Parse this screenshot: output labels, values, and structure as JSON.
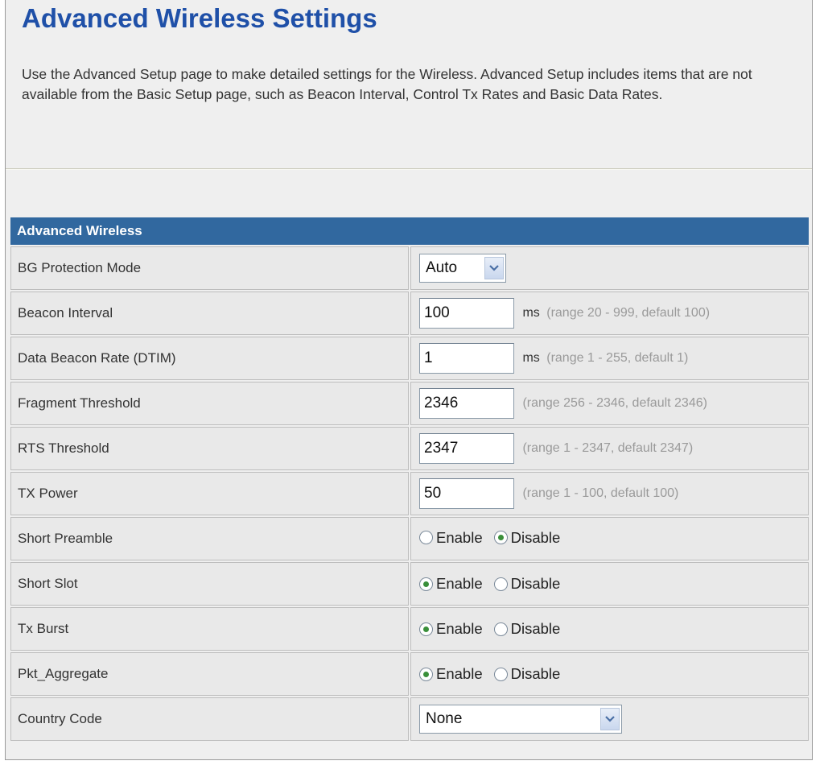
{
  "page": {
    "title": "Advanced Wireless Settings",
    "description": "Use the Advanced Setup page to make detailed settings for the Wireless. Advanced Setup includes items that are not available from the Basic Setup page, such as Beacon Interval, Control Tx Rates and Basic Data Rates."
  },
  "table": {
    "header": "Advanced Wireless",
    "bg_protection": {
      "label": "BG Protection Mode",
      "value": "Auto"
    },
    "beacon_interval": {
      "label": "Beacon Interval",
      "value": "100",
      "unit": "ms",
      "hint": "(range 20 - 999, default 100)"
    },
    "dtim": {
      "label": "Data Beacon Rate (DTIM)",
      "value": "1",
      "unit": "ms",
      "hint": "(range 1 - 255, default 1)"
    },
    "fragment": {
      "label": "Fragment Threshold",
      "value": "2346",
      "hint": "(range 256 - 2346, default 2346)"
    },
    "rts": {
      "label": "RTS Threshold",
      "value": "2347",
      "hint": "(range 1 - 2347, default 2347)"
    },
    "tx_power": {
      "label": "TX Power",
      "value": "50",
      "hint": "(range 1 - 100, default 100)"
    },
    "short_preamble": {
      "label": "Short Preamble",
      "enable": "Enable",
      "disable": "Disable",
      "selected": "disable"
    },
    "short_slot": {
      "label": "Short Slot",
      "enable": "Enable",
      "disable": "Disable",
      "selected": "enable"
    },
    "tx_burst": {
      "label": "Tx Burst",
      "enable": "Enable",
      "disable": "Disable",
      "selected": "enable"
    },
    "pkt_aggregate": {
      "label": "Pkt_Aggregate",
      "enable": "Enable",
      "disable": "Disable",
      "selected": "enable"
    },
    "country_code": {
      "label": "Country Code",
      "value": "None"
    }
  },
  "colors": {
    "title": "#1f50a8",
    "header_bg": "#31689f",
    "radio_checked": "#3a8f3a",
    "hint_text": "#9a9a9a"
  },
  "icons": {
    "dropdown": "chevron-down-icon",
    "radio": "radio-button-icon"
  }
}
